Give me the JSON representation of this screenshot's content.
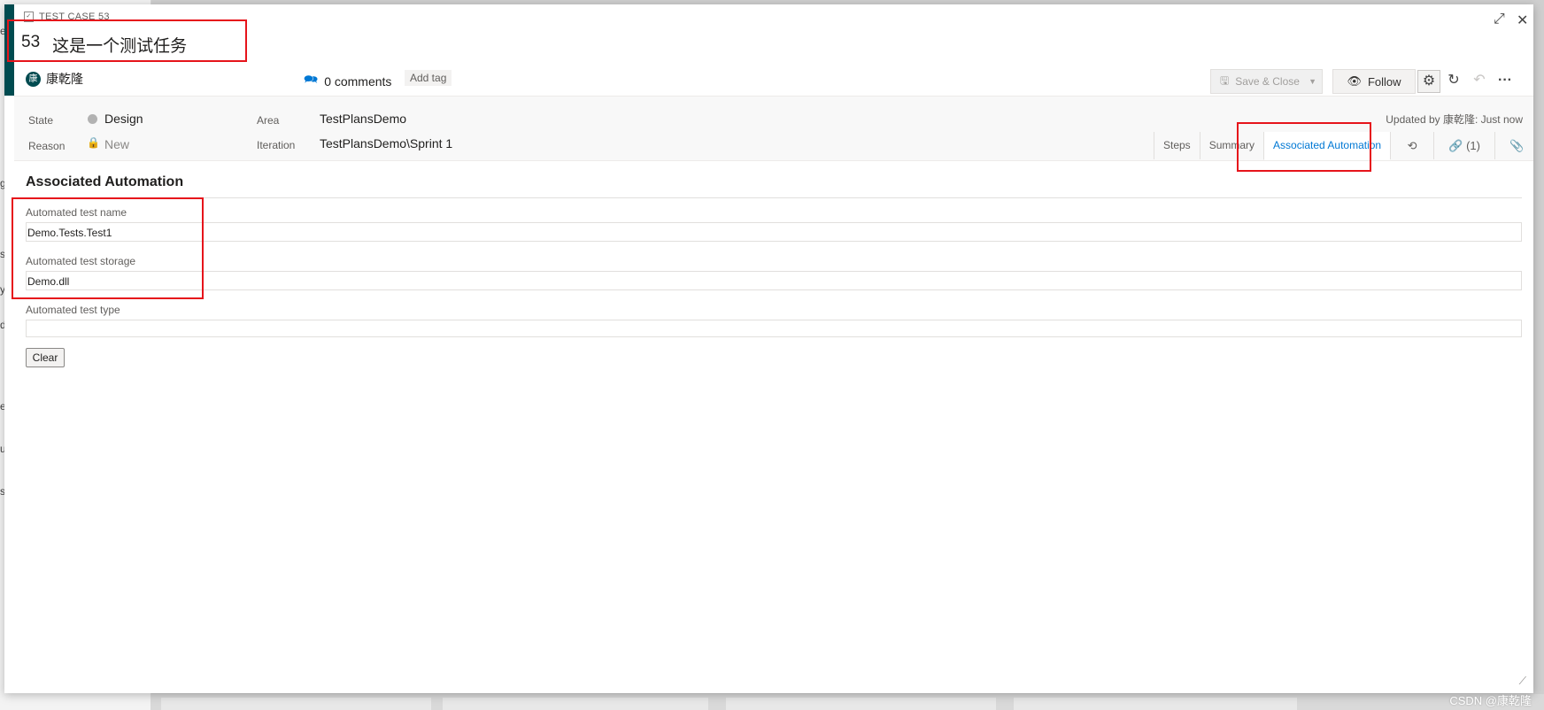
{
  "background": {
    "left_fragments": [
      "e",
      "g",
      "s",
      "y",
      "d",
      "e",
      "u",
      "s"
    ]
  },
  "header": {
    "work_item_type": "TEST CASE 53",
    "id": "53",
    "title": "这是一个测试任务",
    "assigned_to": "康乾隆",
    "avatar_initial": "康",
    "comments": "0 comments",
    "add_tag": "Add tag"
  },
  "toolbar": {
    "save_close": "Save & Close",
    "follow": "Follow"
  },
  "fields": {
    "state_label": "State",
    "state_value": "Design",
    "reason_label": "Reason",
    "reason_value": "New",
    "area_label": "Area",
    "area_value": "TestPlansDemo",
    "iteration_label": "Iteration",
    "iteration_value": "TestPlansDemo\\Sprint 1",
    "updated": "Updated by 康乾隆: Just now"
  },
  "tabs": {
    "steps": "Steps",
    "summary": "Summary",
    "associated_automation": "Associated Automation",
    "links_count": "(1)"
  },
  "content": {
    "section_title": "Associated Automation",
    "test_name_label": "Automated test name",
    "test_name_value": "Demo.Tests.Test1",
    "test_storage_label": "Automated test storage",
    "test_storage_value": "Demo.dll",
    "test_type_label": "Automated test type",
    "test_type_value": "",
    "clear_button": "Clear"
  },
  "watermark": "CSDN @康乾隆",
  "colors": {
    "accent": "#0078d4",
    "type_bar": "#004b50",
    "annotation": "#e6141b"
  }
}
